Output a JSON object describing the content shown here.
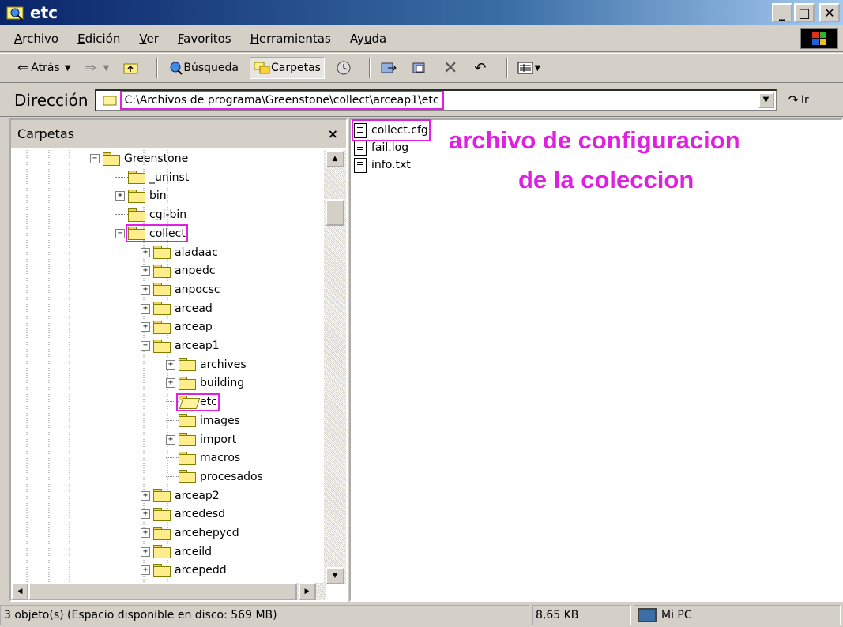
{
  "window": {
    "title": "etc"
  },
  "menu": [
    {
      "prefix": "",
      "key": "A",
      "rest": "rchivo"
    },
    {
      "prefix": "",
      "key": "E",
      "rest": "dición"
    },
    {
      "prefix": "",
      "key": "V",
      "rest": "er"
    },
    {
      "prefix": "",
      "key": "F",
      "rest": "avoritos"
    },
    {
      "prefix": "",
      "key": "H",
      "rest": "erramientas"
    },
    {
      "prefix": "Ay",
      "key": "u",
      "rest": "da"
    }
  ],
  "toolbar": {
    "back_label": "Atrás",
    "search_label": "Búsqueda",
    "folders_label": "Carpetas"
  },
  "address": {
    "label": "Dirección",
    "value": "C:\\Archivos de programa\\Greenstone\\collect\\arceap1\\etc",
    "go_label": "Ir"
  },
  "folders_pane": {
    "title": "Carpetas",
    "close": "×",
    "tree": [
      {
        "label": "Greenstone",
        "level": 0,
        "expander": "-",
        "highlight": false,
        "open": false
      },
      {
        "label": "_uninst",
        "level": 1,
        "expander": "",
        "highlight": false,
        "open": false
      },
      {
        "label": "bin",
        "level": 1,
        "expander": "+",
        "highlight": false,
        "open": false
      },
      {
        "label": "cgi-bin",
        "level": 1,
        "expander": "",
        "highlight": false,
        "open": false
      },
      {
        "label": "collect",
        "level": 1,
        "expander": "-",
        "highlight": true,
        "open": false
      },
      {
        "label": "aladaac",
        "level": 2,
        "expander": "+",
        "highlight": false,
        "open": false
      },
      {
        "label": "anpedc",
        "level": 2,
        "expander": "+",
        "highlight": false,
        "open": false
      },
      {
        "label": "anpocsc",
        "level": 2,
        "expander": "+",
        "highlight": false,
        "open": false
      },
      {
        "label": "arcead",
        "level": 2,
        "expander": "+",
        "highlight": false,
        "open": false
      },
      {
        "label": "arceap",
        "level": 2,
        "expander": "+",
        "highlight": false,
        "open": false
      },
      {
        "label": "arceap1",
        "level": 2,
        "expander": "-",
        "highlight": false,
        "open": false
      },
      {
        "label": "archives",
        "level": 3,
        "expander": "+",
        "highlight": false,
        "open": false
      },
      {
        "label": "building",
        "level": 3,
        "expander": "+",
        "highlight": false,
        "open": false
      },
      {
        "label": "etc",
        "level": 3,
        "expander": "",
        "highlight": true,
        "open": true
      },
      {
        "label": "images",
        "level": 3,
        "expander": "",
        "highlight": false,
        "open": false
      },
      {
        "label": "import",
        "level": 3,
        "expander": "+",
        "highlight": false,
        "open": false
      },
      {
        "label": "macros",
        "level": 3,
        "expander": "",
        "highlight": false,
        "open": false
      },
      {
        "label": "procesados",
        "level": 3,
        "expander": "",
        "highlight": false,
        "open": false
      },
      {
        "label": "arceap2",
        "level": 2,
        "expander": "+",
        "highlight": false,
        "open": false
      },
      {
        "label": "arcedesd",
        "level": 2,
        "expander": "+",
        "highlight": false,
        "open": false
      },
      {
        "label": "arcehepycd",
        "level": 2,
        "expander": "+",
        "highlight": false,
        "open": false
      },
      {
        "label": "arceild",
        "level": 2,
        "expander": "+",
        "highlight": false,
        "open": false
      },
      {
        "label": "arcepedd",
        "level": 2,
        "expander": "+",
        "highlight": false,
        "open": false
      }
    ]
  },
  "files": [
    {
      "name": "collect.cfg",
      "highlight": true
    },
    {
      "name": "fail.log",
      "highlight": false
    },
    {
      "name": "info.txt",
      "highlight": false
    }
  ],
  "annotation": {
    "line1": "archivo de configuracion",
    "line2": "de la coleccion",
    "color": "#e020e0"
  },
  "status": {
    "objects": "3 objeto(s) (Espacio disponible en disco: 569 MB)",
    "size": "8,65 KB",
    "location": "Mi PC"
  }
}
